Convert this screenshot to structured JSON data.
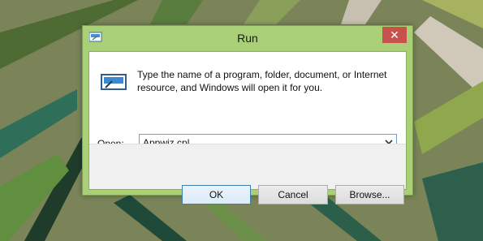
{
  "window": {
    "title": "Run",
    "close_label": "✕",
    "description": "Type the name of a program, folder, document, or Internet resource, and Windows will open it for you.",
    "open_label": "Open:",
    "open_value": "Appwiz.cpl",
    "buttons": {
      "ok": "OK",
      "cancel": "Cancel",
      "browse": "Browse..."
    }
  },
  "colors": {
    "frame": "#a9cf77",
    "close": "#c7514d",
    "accent": "#3c7fb1"
  },
  "icons": [
    "run-icon",
    "close-icon",
    "chevron-down-icon"
  ]
}
